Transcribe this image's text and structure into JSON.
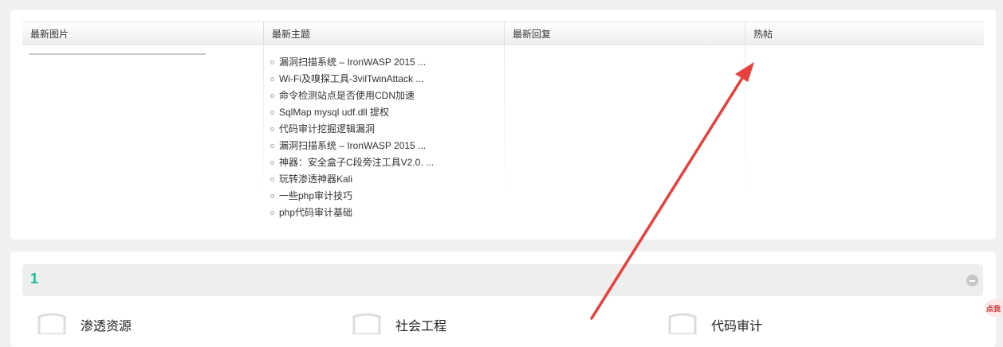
{
  "latest_panel": {
    "columns": [
      "最新图片",
      "最新主题",
      "最新回复",
      "热帖"
    ],
    "latest_topics": [
      "漏洞扫描系统 – IronWASP 2015 ...",
      "Wi-Fi及嗅探工具-3vilTwinAttack ...",
      "命令检测站点是否使用CDN加速",
      "SqlMap mysql udf.dll 提权",
      "代码审计挖掘逻辑漏洞",
      "漏洞扫描系统 – IronWASP 2015 ...",
      "神器：安全盒子C段旁注工具V2.0. ...",
      "玩转渗透神器Kali",
      "一些php审计技巧",
      "php代码审计基础"
    ]
  },
  "section": {
    "title": "1",
    "accent_color": "#1abc9c",
    "forums": [
      {
        "name": "渗透资源",
        "icon": "shield-icon"
      },
      {
        "name": "社会工程",
        "icon": "shield-icon"
      },
      {
        "name": "代码审计",
        "icon": "shield-icon"
      }
    ]
  },
  "floating_badge": {
    "label": "点我"
  },
  "annotation": {
    "color": "#e8403c",
    "icon": "red-arrow-icon"
  }
}
